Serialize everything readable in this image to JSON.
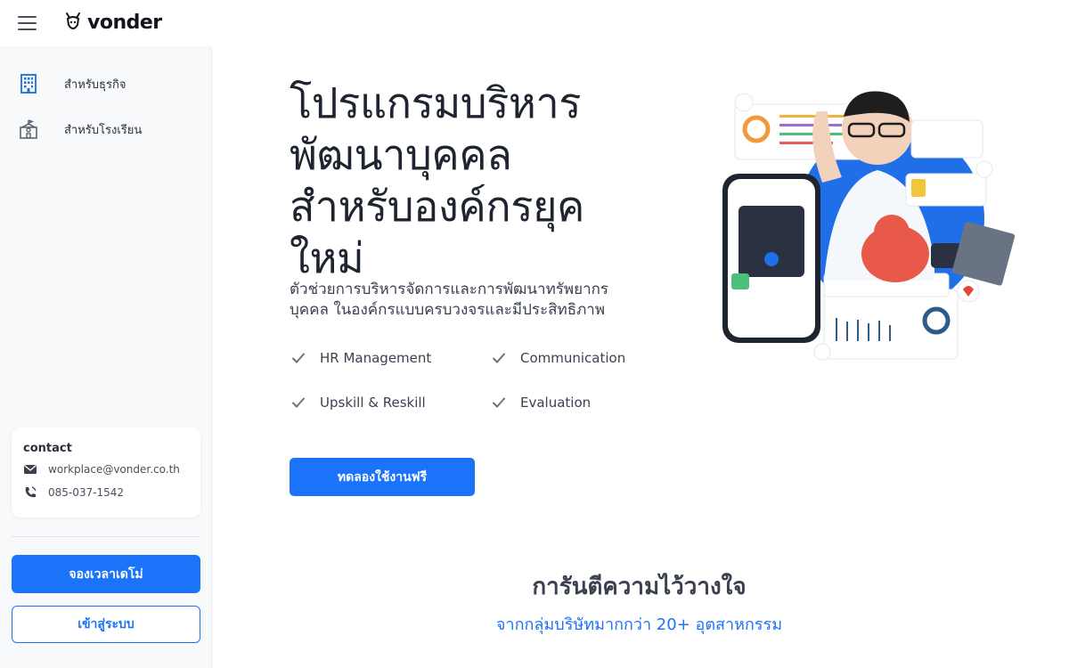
{
  "brand": {
    "name": "vonder"
  },
  "sidebar": {
    "items": [
      {
        "label": "สำหรับธุรกิจ",
        "icon": "building-icon"
      },
      {
        "label": "สำหรับโรงเรียน",
        "icon": "school-icon"
      }
    ],
    "contact": {
      "title": "contact",
      "email": "workplace@vonder.co.th",
      "phone": "085-037-1542"
    },
    "book_demo_label": "จองเวลาเดโม่",
    "login_label": "เข้าสู่ระบบ"
  },
  "hero": {
    "title_lines": [
      "โปรแกรมบริหาร",
      "พัฒนาบุคคล",
      "สำหรับองค์กรยุค",
      "ใหม่"
    ],
    "subtitle_lines": [
      "ตัวช่วยการบริหารจัดการและการพัฒนาทรัพยากร",
      "บุคคล ในองค์กรแบบครบวงจรและมีประสิทธิภาพ"
    ],
    "features": [
      "HR Management",
      "Communication",
      "Upskill & Reskill",
      "Evaluation"
    ],
    "cta_label": "ทดลองใช้งานฟรี"
  },
  "trust": {
    "title": "การันตีความไว้วางใจ",
    "subtitle": "จากกลุ่มบริษัทมากกว่า 20+ อุตสาหกรรม"
  },
  "colors": {
    "accent": "#1a73f8",
    "text": "#1e2430",
    "sidebar_bg": "#f7f9fb"
  }
}
